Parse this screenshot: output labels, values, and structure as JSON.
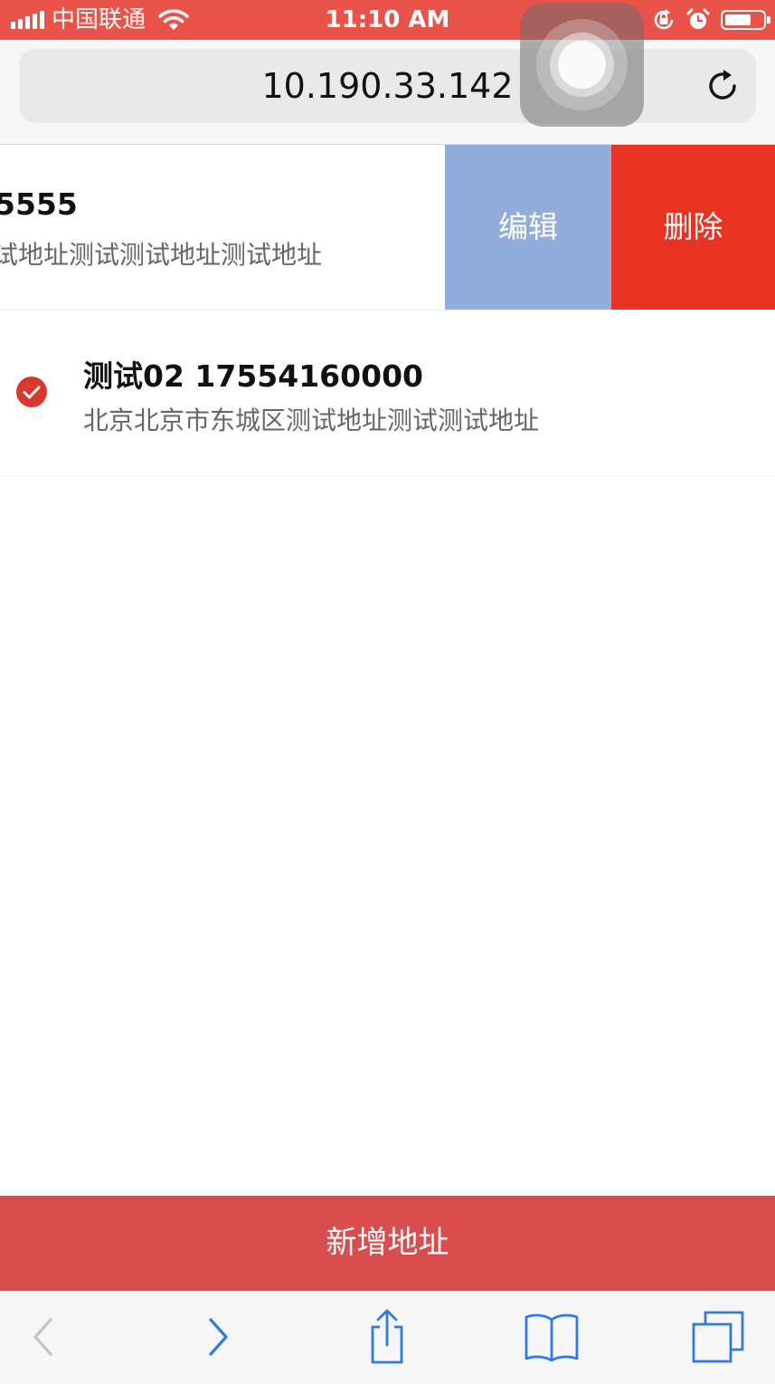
{
  "status_bar": {
    "carrier": "中国联通",
    "time": "11:10 AM",
    "battery_level": 0.7
  },
  "browser": {
    "url": "10.190.33.142"
  },
  "addresses": [
    {
      "name_phone": "5555",
      "address": "试地址测试测试地址测试地址",
      "actions": {
        "edit": "编辑",
        "delete": "删除"
      }
    },
    {
      "name_phone": "测试02 17554160000",
      "address": "北京北京市东城区测试地址测试测试地址",
      "selected": true
    }
  ],
  "add_button_label": "新增地址",
  "colors": {
    "status_bar": "#ea5349",
    "edit_action": "#92acdc",
    "delete_action": "#e93322",
    "add_button": "#d94d4f",
    "check": "#d9382c",
    "toolbar_icon": "#2f7ae5"
  },
  "toolbar": {
    "icons": [
      "back-icon",
      "forward-icon",
      "share-icon",
      "bookmarks-icon",
      "tabs-icon"
    ]
  }
}
